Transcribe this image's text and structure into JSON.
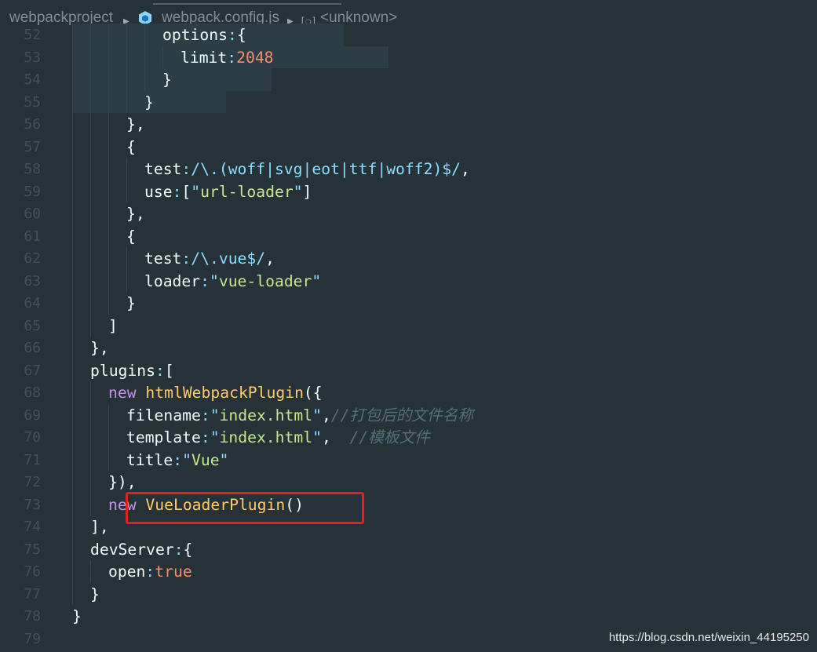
{
  "breadcrumb": {
    "project": "webpackproject",
    "file": "webpack.config.js",
    "symbol": "<unknown>",
    "file_icon": "webpack-cube-icon",
    "symbol_icon": "symbol-field-icon",
    "separator": "▶"
  },
  "colors": {
    "background": "#263238",
    "punctuation": "#89ddff",
    "string": "#c3e88d",
    "keyword": "#c792ea",
    "function": "#ffcb6b",
    "number": "#f78c6c",
    "comment": "#546e7a",
    "highlight_box": "#e6201a"
  },
  "lines": [
    {
      "num": "52",
      "indent": 10,
      "tokens": [
        [
          "def",
          "options"
        ],
        [
          "punc",
          ":"
        ],
        [
          "br",
          "{"
        ]
      ]
    },
    {
      "num": "53",
      "indent": 12,
      "tokens": [
        [
          "def",
          "limit"
        ],
        [
          "punc",
          ":"
        ],
        [
          "num",
          "2048"
        ]
      ]
    },
    {
      "num": "54",
      "indent": 10,
      "tokens": [
        [
          "br",
          "}"
        ]
      ]
    },
    {
      "num": "55",
      "indent": 8,
      "tokens": [
        [
          "br",
          "}"
        ]
      ]
    },
    {
      "num": "56",
      "indent": 6,
      "tokens": [
        [
          "br",
          "}"
        ],
        [
          "def",
          ","
        ]
      ]
    },
    {
      "num": "57",
      "indent": 6,
      "tokens": [
        [
          "br",
          "{"
        ]
      ]
    },
    {
      "num": "58",
      "indent": 8,
      "tokens": [
        [
          "def",
          "test"
        ],
        [
          "punc",
          ":"
        ],
        [
          "reg",
          "/\\.(woff|svg|eot|ttf|woff2)$/"
        ],
        [
          "def",
          ","
        ]
      ]
    },
    {
      "num": "59",
      "indent": 8,
      "tokens": [
        [
          "def",
          "use"
        ],
        [
          "punc",
          ":"
        ],
        [
          "def",
          "["
        ],
        [
          "punc",
          "\""
        ],
        [
          "str",
          "url-loader"
        ],
        [
          "punc",
          "\""
        ],
        [
          "def",
          "]"
        ]
      ]
    },
    {
      "num": "60",
      "indent": 6,
      "tokens": [
        [
          "br",
          "}"
        ],
        [
          "def",
          ","
        ]
      ]
    },
    {
      "num": "61",
      "indent": 6,
      "tokens": [
        [
          "br",
          "{"
        ]
      ]
    },
    {
      "num": "62",
      "indent": 8,
      "tokens": [
        [
          "def",
          "test"
        ],
        [
          "punc",
          ":"
        ],
        [
          "reg",
          "/\\.vue$/"
        ],
        [
          "def",
          ","
        ]
      ]
    },
    {
      "num": "63",
      "indent": 8,
      "tokens": [
        [
          "def",
          "loader"
        ],
        [
          "punc",
          ":"
        ],
        [
          "punc",
          "\""
        ],
        [
          "str",
          "vue-loader"
        ],
        [
          "punc",
          "\""
        ]
      ]
    },
    {
      "num": "64",
      "indent": 6,
      "tokens": [
        [
          "br",
          "}"
        ]
      ]
    },
    {
      "num": "65",
      "indent": 4,
      "tokens": [
        [
          "def",
          "]"
        ]
      ]
    },
    {
      "num": "66",
      "indent": 2,
      "tokens": [
        [
          "br",
          "}"
        ],
        [
          "def",
          ","
        ]
      ]
    },
    {
      "num": "67",
      "indent": 2,
      "tokens": [
        [
          "def",
          "plugins"
        ],
        [
          "punc",
          ":"
        ],
        [
          "def",
          "["
        ]
      ]
    },
    {
      "num": "68",
      "indent": 4,
      "tokens": [
        [
          "kw",
          "new "
        ],
        [
          "fn",
          "htmlWebpackPlugin"
        ],
        [
          "def",
          "({"
        ]
      ]
    },
    {
      "num": "69",
      "indent": 6,
      "tokens": [
        [
          "def",
          "filename"
        ],
        [
          "punc",
          ":"
        ],
        [
          "punc",
          "\""
        ],
        [
          "str",
          "index.html"
        ],
        [
          "punc",
          "\""
        ],
        [
          "def",
          ","
        ],
        [
          "com",
          "//打包后的文件名称"
        ]
      ]
    },
    {
      "num": "70",
      "indent": 6,
      "tokens": [
        [
          "def",
          "template"
        ],
        [
          "punc",
          ":"
        ],
        [
          "punc",
          "\""
        ],
        [
          "str",
          "index.html"
        ],
        [
          "punc",
          "\""
        ],
        [
          "def",
          ",  "
        ],
        [
          "com",
          "//模板文件"
        ]
      ]
    },
    {
      "num": "71",
      "indent": 6,
      "tokens": [
        [
          "def",
          "title"
        ],
        [
          "punc",
          ":"
        ],
        [
          "punc",
          "\""
        ],
        [
          "str",
          "Vue"
        ],
        [
          "punc",
          "\""
        ]
      ]
    },
    {
      "num": "72",
      "indent": 4,
      "tokens": [
        [
          "def",
          "}),"
        ]
      ]
    },
    {
      "num": "73",
      "indent": 4,
      "tokens": [
        [
          "kw",
          "new "
        ],
        [
          "fn",
          "VueLoaderPlugin"
        ],
        [
          "def",
          "()"
        ]
      ]
    },
    {
      "num": "74",
      "indent": 2,
      "tokens": [
        [
          "def",
          "],"
        ]
      ]
    },
    {
      "num": "75",
      "indent": 2,
      "tokens": [
        [
          "def",
          "devServer"
        ],
        [
          "punc",
          ":"
        ],
        [
          "br",
          "{"
        ]
      ]
    },
    {
      "num": "76",
      "indent": 4,
      "tokens": [
        [
          "def",
          "open"
        ],
        [
          "punc",
          ":"
        ],
        [
          "bool",
          "true"
        ]
      ]
    },
    {
      "num": "77",
      "indent": 2,
      "tokens": [
        [
          "br",
          "}"
        ]
      ]
    },
    {
      "num": "78",
      "indent": 0,
      "tokens": [
        [
          "br",
          "}"
        ]
      ]
    },
    {
      "num": "79",
      "indent": 0,
      "tokens": []
    }
  ],
  "watermark": "https://blog.csdn.net/weixin_44195250"
}
